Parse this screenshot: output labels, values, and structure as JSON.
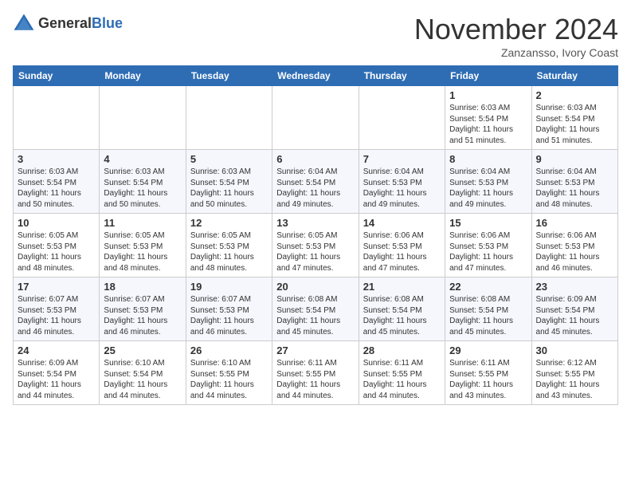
{
  "header": {
    "logo_general": "General",
    "logo_blue": "Blue",
    "month_title": "November 2024",
    "location": "Zanzansso, Ivory Coast"
  },
  "weekdays": [
    "Sunday",
    "Monday",
    "Tuesday",
    "Wednesday",
    "Thursday",
    "Friday",
    "Saturday"
  ],
  "weeks": [
    [
      {
        "day": "",
        "info": ""
      },
      {
        "day": "",
        "info": ""
      },
      {
        "day": "",
        "info": ""
      },
      {
        "day": "",
        "info": ""
      },
      {
        "day": "",
        "info": ""
      },
      {
        "day": "1",
        "info": "Sunrise: 6:03 AM\nSunset: 5:54 PM\nDaylight: 11 hours and 51 minutes."
      },
      {
        "day": "2",
        "info": "Sunrise: 6:03 AM\nSunset: 5:54 PM\nDaylight: 11 hours and 51 minutes."
      }
    ],
    [
      {
        "day": "3",
        "info": "Sunrise: 6:03 AM\nSunset: 5:54 PM\nDaylight: 11 hours and 50 minutes."
      },
      {
        "day": "4",
        "info": "Sunrise: 6:03 AM\nSunset: 5:54 PM\nDaylight: 11 hours and 50 minutes."
      },
      {
        "day": "5",
        "info": "Sunrise: 6:03 AM\nSunset: 5:54 PM\nDaylight: 11 hours and 50 minutes."
      },
      {
        "day": "6",
        "info": "Sunrise: 6:04 AM\nSunset: 5:54 PM\nDaylight: 11 hours and 49 minutes."
      },
      {
        "day": "7",
        "info": "Sunrise: 6:04 AM\nSunset: 5:53 PM\nDaylight: 11 hours and 49 minutes."
      },
      {
        "day": "8",
        "info": "Sunrise: 6:04 AM\nSunset: 5:53 PM\nDaylight: 11 hours and 49 minutes."
      },
      {
        "day": "9",
        "info": "Sunrise: 6:04 AM\nSunset: 5:53 PM\nDaylight: 11 hours and 48 minutes."
      }
    ],
    [
      {
        "day": "10",
        "info": "Sunrise: 6:05 AM\nSunset: 5:53 PM\nDaylight: 11 hours and 48 minutes."
      },
      {
        "day": "11",
        "info": "Sunrise: 6:05 AM\nSunset: 5:53 PM\nDaylight: 11 hours and 48 minutes."
      },
      {
        "day": "12",
        "info": "Sunrise: 6:05 AM\nSunset: 5:53 PM\nDaylight: 11 hours and 48 minutes."
      },
      {
        "day": "13",
        "info": "Sunrise: 6:05 AM\nSunset: 5:53 PM\nDaylight: 11 hours and 47 minutes."
      },
      {
        "day": "14",
        "info": "Sunrise: 6:06 AM\nSunset: 5:53 PM\nDaylight: 11 hours and 47 minutes."
      },
      {
        "day": "15",
        "info": "Sunrise: 6:06 AM\nSunset: 5:53 PM\nDaylight: 11 hours and 47 minutes."
      },
      {
        "day": "16",
        "info": "Sunrise: 6:06 AM\nSunset: 5:53 PM\nDaylight: 11 hours and 46 minutes."
      }
    ],
    [
      {
        "day": "17",
        "info": "Sunrise: 6:07 AM\nSunset: 5:53 PM\nDaylight: 11 hours and 46 minutes."
      },
      {
        "day": "18",
        "info": "Sunrise: 6:07 AM\nSunset: 5:53 PM\nDaylight: 11 hours and 46 minutes."
      },
      {
        "day": "19",
        "info": "Sunrise: 6:07 AM\nSunset: 5:53 PM\nDaylight: 11 hours and 46 minutes."
      },
      {
        "day": "20",
        "info": "Sunrise: 6:08 AM\nSunset: 5:54 PM\nDaylight: 11 hours and 45 minutes."
      },
      {
        "day": "21",
        "info": "Sunrise: 6:08 AM\nSunset: 5:54 PM\nDaylight: 11 hours and 45 minutes."
      },
      {
        "day": "22",
        "info": "Sunrise: 6:08 AM\nSunset: 5:54 PM\nDaylight: 11 hours and 45 minutes."
      },
      {
        "day": "23",
        "info": "Sunrise: 6:09 AM\nSunset: 5:54 PM\nDaylight: 11 hours and 45 minutes."
      }
    ],
    [
      {
        "day": "24",
        "info": "Sunrise: 6:09 AM\nSunset: 5:54 PM\nDaylight: 11 hours and 44 minutes."
      },
      {
        "day": "25",
        "info": "Sunrise: 6:10 AM\nSunset: 5:54 PM\nDaylight: 11 hours and 44 minutes."
      },
      {
        "day": "26",
        "info": "Sunrise: 6:10 AM\nSunset: 5:55 PM\nDaylight: 11 hours and 44 minutes."
      },
      {
        "day": "27",
        "info": "Sunrise: 6:11 AM\nSunset: 5:55 PM\nDaylight: 11 hours and 44 minutes."
      },
      {
        "day": "28",
        "info": "Sunrise: 6:11 AM\nSunset: 5:55 PM\nDaylight: 11 hours and 44 minutes."
      },
      {
        "day": "29",
        "info": "Sunrise: 6:11 AM\nSunset: 5:55 PM\nDaylight: 11 hours and 43 minutes."
      },
      {
        "day": "30",
        "info": "Sunrise: 6:12 AM\nSunset: 5:55 PM\nDaylight: 11 hours and 43 minutes."
      }
    ]
  ]
}
